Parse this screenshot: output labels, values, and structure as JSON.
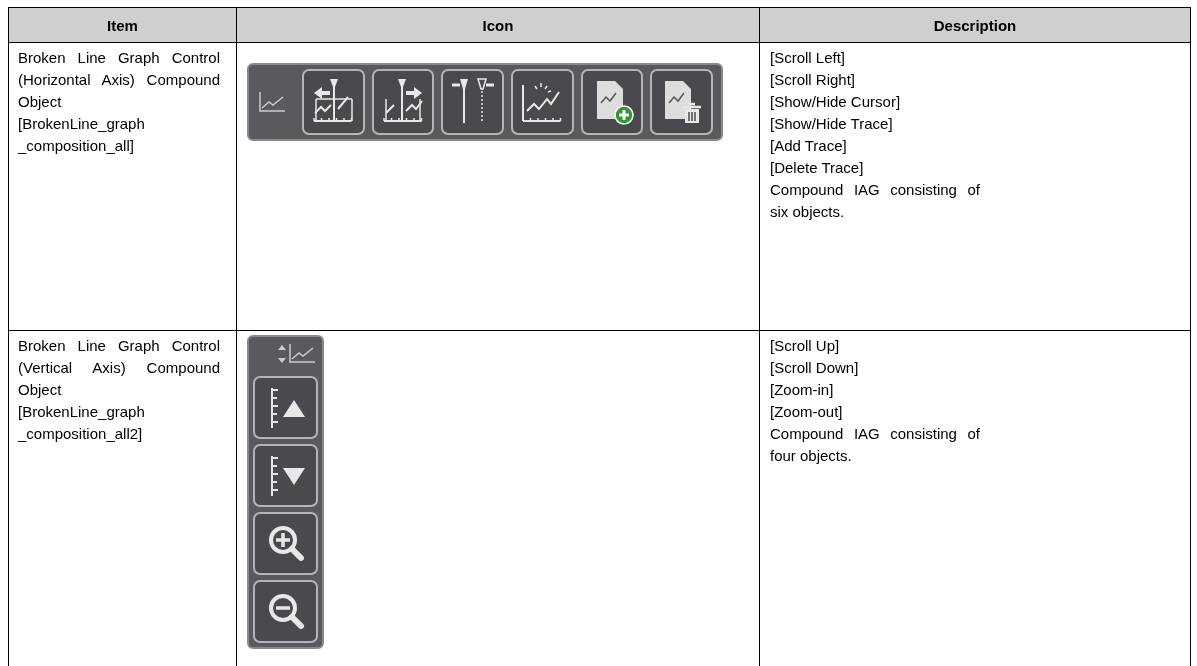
{
  "table": {
    "columns": [
      "Item",
      "Icon",
      "Description"
    ],
    "rows": [
      {
        "item": {
          "name": "Broken Line Graph Control (Horizontal Axis) Compound Object",
          "code": [
            "[BrokenLine_graph",
            "_composition_all]"
          ]
        },
        "icon_panel": {
          "kind": "horizontal"
        },
        "description": [
          "[Scroll Left]",
          "[Scroll Right]",
          "[Show/Hide Cursor]",
          "[Show/Hide Trace]",
          "[Add Trace]",
          "[Delete Trace]",
          "Compound IAG consisting of six objects."
        ]
      },
      {
        "item": {
          "name": "Broken Line Graph Control (Vertical Axis) Compound Object",
          "code": [
            "[BrokenLine_graph",
            "_composition_all2]"
          ]
        },
        "icon_panel": {
          "kind": "vertical"
        },
        "description": [
          "[Scroll Up]",
          "[Scroll Down]",
          "[Zoom-in]",
          "[Zoom-out]",
          "Compound IAG consisting of four objects."
        ]
      }
    ]
  }
}
